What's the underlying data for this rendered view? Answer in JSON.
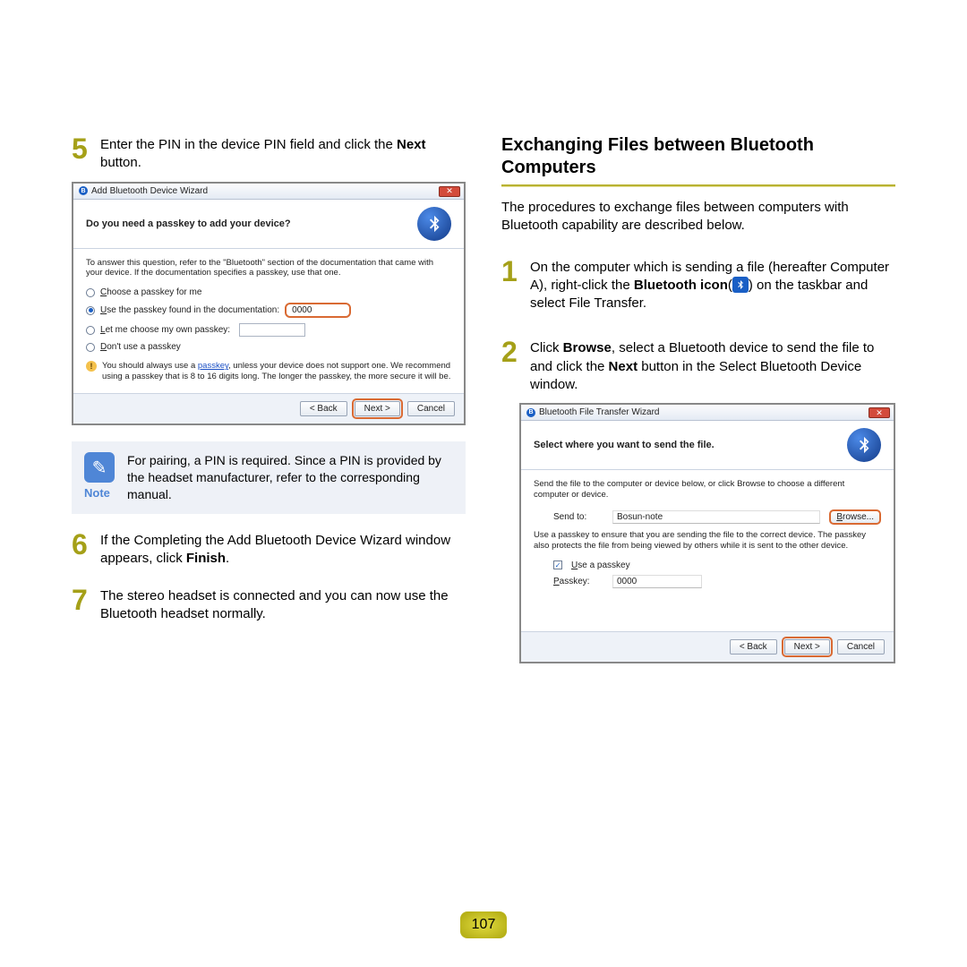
{
  "left": {
    "step5": {
      "num": "5",
      "text_a": "Enter the PIN in the device PIN field and click the ",
      "bold": "Next",
      "text_b": " button."
    },
    "dialog1": {
      "title": "Add Bluetooth Device Wizard",
      "heading": "Do you need a passkey to add your device?",
      "desc": "To answer this question, refer to the \"Bluetooth\" section of the documentation that came with your device. If the documentation specifies a passkey, use that one.",
      "opt1": "Choose a passkey for me",
      "opt2": "Use the passkey found in the documentation:",
      "opt2_val": "0000",
      "opt3": "Let me choose my own passkey:",
      "opt4": "Don't use a passkey",
      "warn_a": "You should always use a ",
      "warn_link": "passkey",
      "warn_b": ", unless your device does not support one. We recommend using a passkey that is 8 to 16 digits long. The longer the passkey, the more secure it will be.",
      "back": "< Back",
      "next": "Next >",
      "cancel": "Cancel"
    },
    "note": {
      "label": "Note",
      "text": "For pairing, a PIN is required. Since a PIN is provided by the headset manufacturer, refer to the corresponding manual."
    },
    "step6": {
      "num": "6",
      "text_a": "If the Completing the Add Bluetooth Device Wizard window appears, click ",
      "bold": "Finish",
      "text_b": "."
    },
    "step7": {
      "num": "7",
      "text": "The stereo headset is connected and you can now use the Bluetooth headset normally."
    }
  },
  "right": {
    "title": "Exchanging Files between Bluetooth Computers",
    "intro": "The procedures to exchange files between computers with Bluetooth capability are described below.",
    "step1": {
      "num": "1",
      "text_a": "On the computer which is sending a file (hereafter Computer A), right-click the ",
      "bold": "Bluetooth icon",
      "text_b": "(",
      "text_c": ") on the taskbar and select File Transfer."
    },
    "step2": {
      "num": "2",
      "text_a": "Click ",
      "bold1": "Browse",
      "text_b": ", select a Bluetooth device to send the file to and click the ",
      "bold2": "Next",
      "text_c": " button in the Select Bluetooth Device window."
    },
    "dialog2": {
      "title": "Bluetooth File Transfer Wizard",
      "heading": "Select where you want to send the file.",
      "desc": "Send the file to the computer or device below, or click Browse to choose a different computer or device.",
      "sendto_label": "Send to:",
      "sendto_val": "Bosun-note",
      "browse": "Browse...",
      "desc2": "Use a passkey to ensure that you are sending the file to the correct device. The passkey also protects the file from being viewed by others while it is sent to the other device.",
      "use_passkey": "Use a passkey",
      "passkey_label": "Passkey:",
      "passkey_val": "0000",
      "back": "< Back",
      "next": "Next >",
      "cancel": "Cancel"
    }
  },
  "pagenum": "107"
}
